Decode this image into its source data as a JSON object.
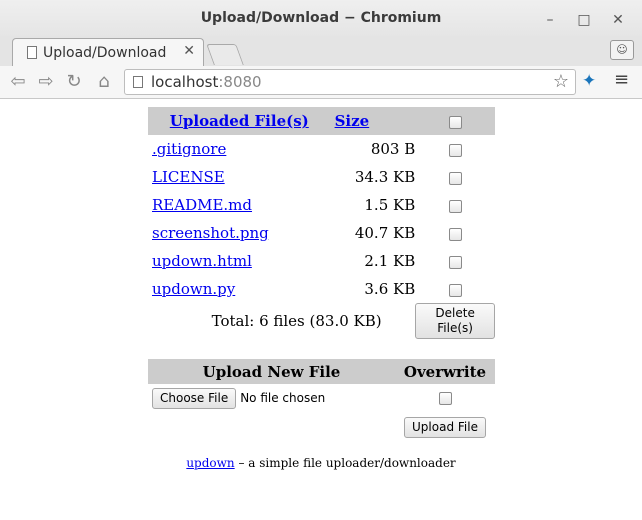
{
  "window": {
    "title": "Upload/Download − Chromium",
    "minimize": "–",
    "maximize": "□",
    "close": "✕"
  },
  "tab": {
    "label": "Upload/Download",
    "close": "✕"
  },
  "toolbar": {
    "url_host": "localhost",
    "url_port": ":8080",
    "back": "⇦",
    "forward": "⇨",
    "reload": "↻",
    "home": "⌂",
    "star": "☆",
    "menu": "≡",
    "extension": "✦",
    "profile": "☺"
  },
  "files_table": {
    "header_name": "Uploaded File(s)",
    "header_size": "Size",
    "rows": [
      {
        "name": ".gitignore",
        "size": "803 B"
      },
      {
        "name": "LICENSE",
        "size": "34.3 KB"
      },
      {
        "name": "README.md",
        "size": "1.5 KB"
      },
      {
        "name": "screenshot.png",
        "size": "40.7 KB"
      },
      {
        "name": "updown.html",
        "size": "2.1 KB"
      },
      {
        "name": "updown.py",
        "size": "3.6 KB"
      }
    ],
    "total": "Total: 6 files (83.0 KB)",
    "delete_button": "Delete File(s)"
  },
  "upload": {
    "header_upload": "Upload New File",
    "header_overwrite": "Overwrite",
    "choose_button": "Choose File",
    "no_file_text": "No file chosen",
    "upload_button": "Upload File"
  },
  "footer": {
    "link": "updown",
    "text": " – a simple file uploader/downloader"
  }
}
